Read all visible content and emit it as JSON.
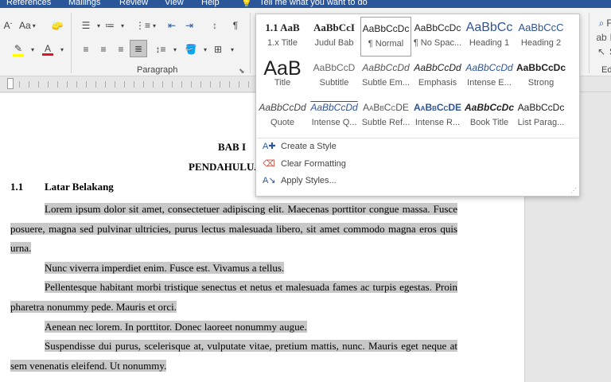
{
  "tabs": {
    "references": "References",
    "mailings": "Mailings",
    "review": "Review",
    "view": "View",
    "help": "Help",
    "tell_me": "Tell me what you want to do"
  },
  "ribbon": {
    "font_grow": "A",
    "font_case": "Aa",
    "clear_fmt": "A̸",
    "highlight_color": "#ffff00",
    "font_color": "#e81123",
    "paragraph_label": "Paragraph",
    "pilcrow": "¶",
    "editing": {
      "find": "F",
      "replace": "R",
      "select": "S",
      "label": "Ed"
    }
  },
  "gallery": {
    "styles": [
      {
        "preview": "1.1  AaB",
        "label": "1.x Title"
      },
      {
        "preview": "AaBbCcI",
        "label": "Judul Bab"
      },
      {
        "preview": "AaBbCcDc",
        "label": "¶ Normal"
      },
      {
        "preview": "AaBbCcDc",
        "label": "¶ No Spac..."
      },
      {
        "preview": "AaBbCc",
        "label": "Heading 1"
      },
      {
        "preview": "AaBbCcC",
        "label": "Heading 2"
      },
      {
        "preview": "AaB",
        "label": "Title"
      },
      {
        "preview": "AaBbCcD",
        "label": "Subtitle"
      },
      {
        "preview": "AaBbCcDd",
        "label": "Subtle Em..."
      },
      {
        "preview": "AaBbCcDd",
        "label": "Emphasis"
      },
      {
        "preview": "AaBbCcDd",
        "label": "Intense E..."
      },
      {
        "preview": "AaBbCcDc",
        "label": "Strong"
      },
      {
        "preview": "AaBbCcDd",
        "label": "Quote"
      },
      {
        "preview": "AaBbCcDd",
        "label": "Intense Q..."
      },
      {
        "preview": "AaBbCcDE",
        "label": "Subtle Ref..."
      },
      {
        "preview": "AaBbCcDE",
        "label": "Intense R..."
      },
      {
        "preview": "AaBbCcDc",
        "label": "Book Title"
      },
      {
        "preview": "AaBbCcDc",
        "label": "List Parag..."
      }
    ],
    "menu": {
      "create": "Create a Style",
      "clear": "Clear Formatting",
      "apply": "Apply Styles..."
    }
  },
  "document": {
    "chapter": "BAB I",
    "chapter_title": "PENDAHULUAN",
    "section_number": "1.1",
    "section_title": "Latar Belakang",
    "paragraphs": [
      "Lorem ipsum dolor sit amet, consectetuer adipiscing elit. Maecenas porttitor congue massa. Fusce posuere, magna sed pulvinar ultricies, purus lectus malesuada libero, sit amet commodo magna eros quis urna.",
      "Nunc viverra imperdiet enim. Fusce est. Vivamus a tellus.",
      "Pellentesque habitant morbi tristique senectus et netus et malesuada fames ac turpis egestas. Proin pharetra nonummy pede. Mauris et orci.",
      "Aenean nec lorem. In porttitor. Donec laoreet nonummy augue.",
      "Suspendisse dui purus, scelerisque at, vulputate vitae, pretium mattis, nunc. Mauris eget neque at sem venenatis eleifend. Ut nonummy."
    ]
  }
}
